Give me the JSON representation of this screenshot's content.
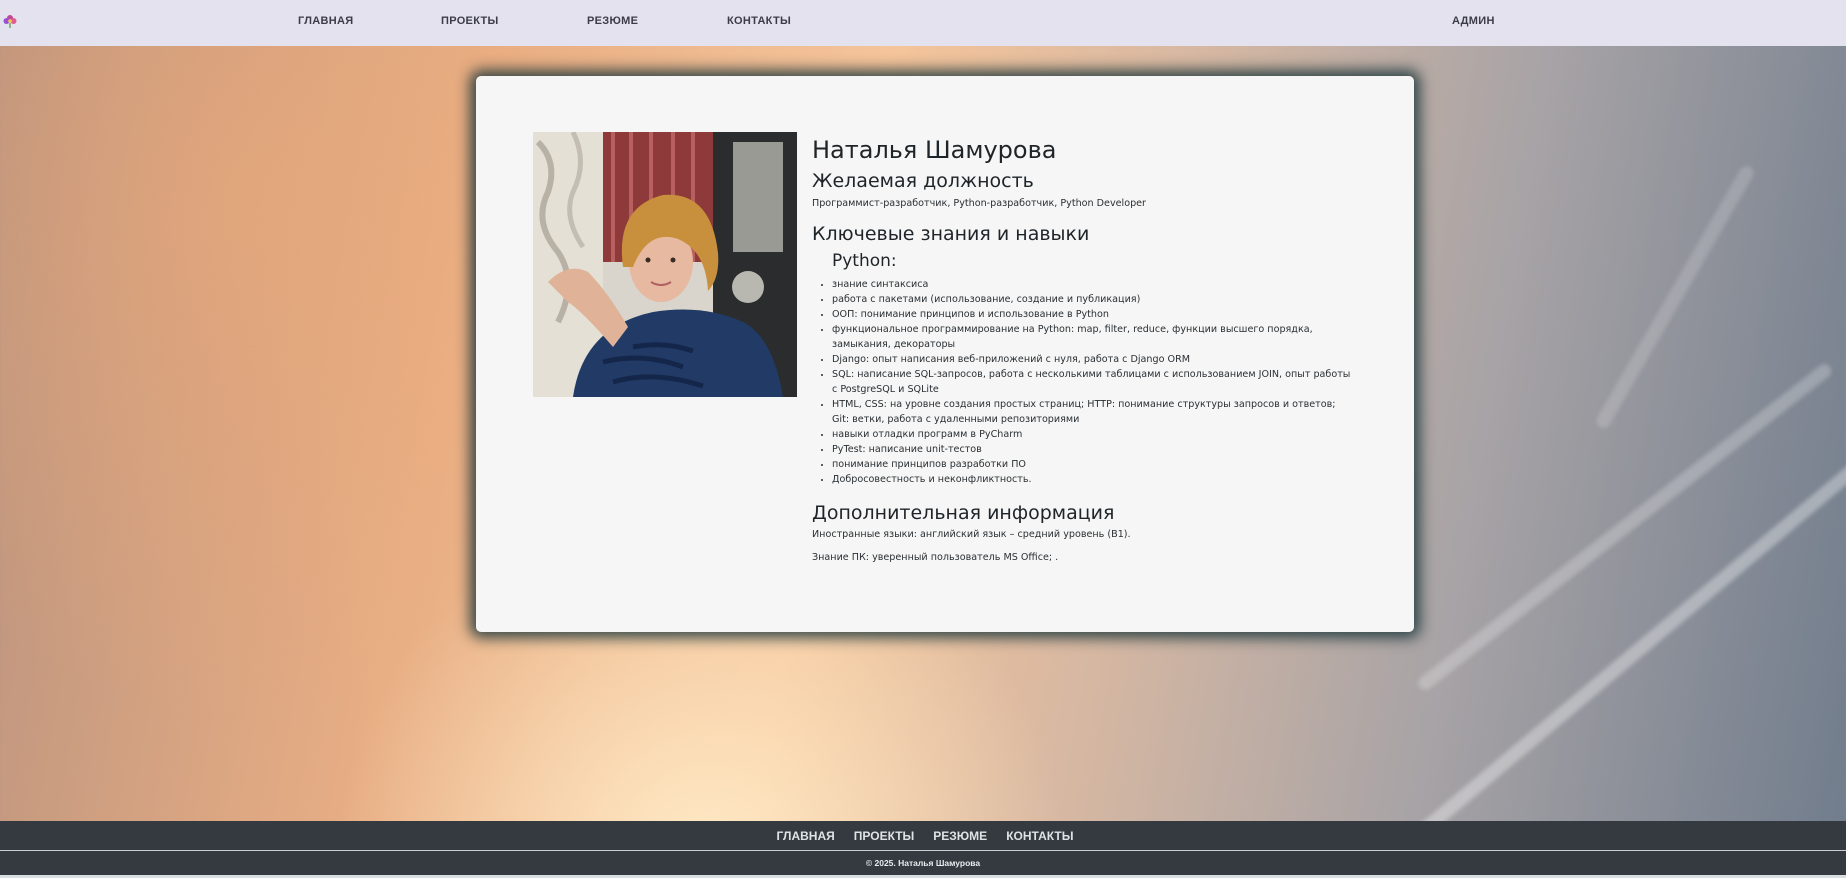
{
  "nav": {
    "home": "ГЛАВНАЯ",
    "projects": "ПРОЕКТЫ",
    "resume": "РЕЗЮМЕ",
    "contacts": "КОНТАКТЫ",
    "admin": "АДМИН"
  },
  "resume": {
    "name": "Наталья Шамурова",
    "desired_position_heading": "Желаемая должность",
    "desired_position": "Программист-разработчик, Python-разработчик, Python Developer",
    "skills_heading": "Ключевые знания и навыки",
    "python_heading": "Python:",
    "skills": [
      "знание синтаксиса",
      "работа с пакетами (использование, создание и публикация)",
      "ООП: понимание принципов и использование в Python",
      "функциональное программирование на Python: map, filter, reduce, функции высшего порядка, замыкания, декораторы",
      "Django: опыт написания веб-приложений с нуля, работа с Django ORM",
      "SQL: написание SQL-запросов, работа с несколькими таблицами с использованием JOIN, опыт работы с PostgreSQL и SQLite",
      "HTML, CSS: на уровне создания простых страниц; HTTP: понимание структуры запросов и ответов; Git: ветки, работа с удаленными репозиториями",
      "навыки отладки программ в PyCharm",
      "PyTest: написание unit-тестов",
      "понимание принципов разработки ПО",
      "Добросовестность и неконфликтность."
    ],
    "extra_heading": "Дополнительная информация",
    "languages": "Иностранные языки: английский язык – средний уровень (B1).",
    "pc_skills": "Знание ПК: уверенный пользователь MS Office; ."
  },
  "footer": {
    "home": "ГЛАВНАЯ",
    "projects": "ПРОЕКТЫ",
    "resume": "РЕЗЮМЕ",
    "contacts": "КОНТАКТЫ",
    "copyright": "© 2025. Наталья Шамурова"
  }
}
